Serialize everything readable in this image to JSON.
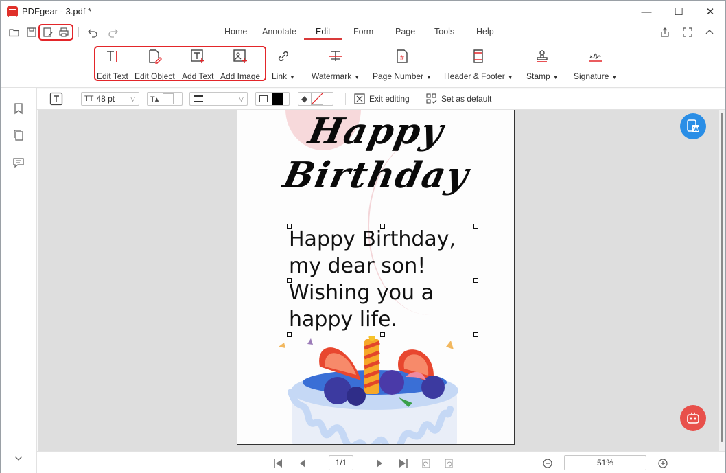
{
  "window": {
    "title": "PDFgear - 3.pdf *",
    "minimize": "—",
    "maximize": "☐",
    "close": "✕"
  },
  "tabs": [
    {
      "label": "Home",
      "active": false
    },
    {
      "label": "Annotate",
      "active": false
    },
    {
      "label": "Edit",
      "active": true
    },
    {
      "label": "Form",
      "active": false
    },
    {
      "label": "Page",
      "active": false
    },
    {
      "label": "Tools",
      "active": false
    },
    {
      "label": "Help",
      "active": false
    }
  ],
  "ribbon": {
    "edit_text": "Edit Text",
    "edit_object": "Edit Object",
    "add_text": "Add Text",
    "add_image": "Add Image",
    "link": "Link",
    "watermark": "Watermark",
    "page_number": "Page Number",
    "header_footer": "Header & Footer",
    "stamp": "Stamp",
    "signature": "Signature"
  },
  "format": {
    "font_size": "48 pt",
    "exit_editing": "Exit editing",
    "set_default": "Set as default",
    "text_color": "#ffffff",
    "border_color": "#000000"
  },
  "document": {
    "title_line1": "Happy",
    "title_line2": "Birthday",
    "greeting": [
      "Happy Birthday,",
      "my dear son!",
      "Wishing you a",
      "happy life."
    ]
  },
  "status": {
    "page_indicator": "1/1",
    "zoom": "51%"
  },
  "colors": {
    "accent": "#d93a3a",
    "highlight_box": "#e3262a",
    "convert_fab": "#2a8ee6",
    "assistant_fab": "#e8504b"
  }
}
